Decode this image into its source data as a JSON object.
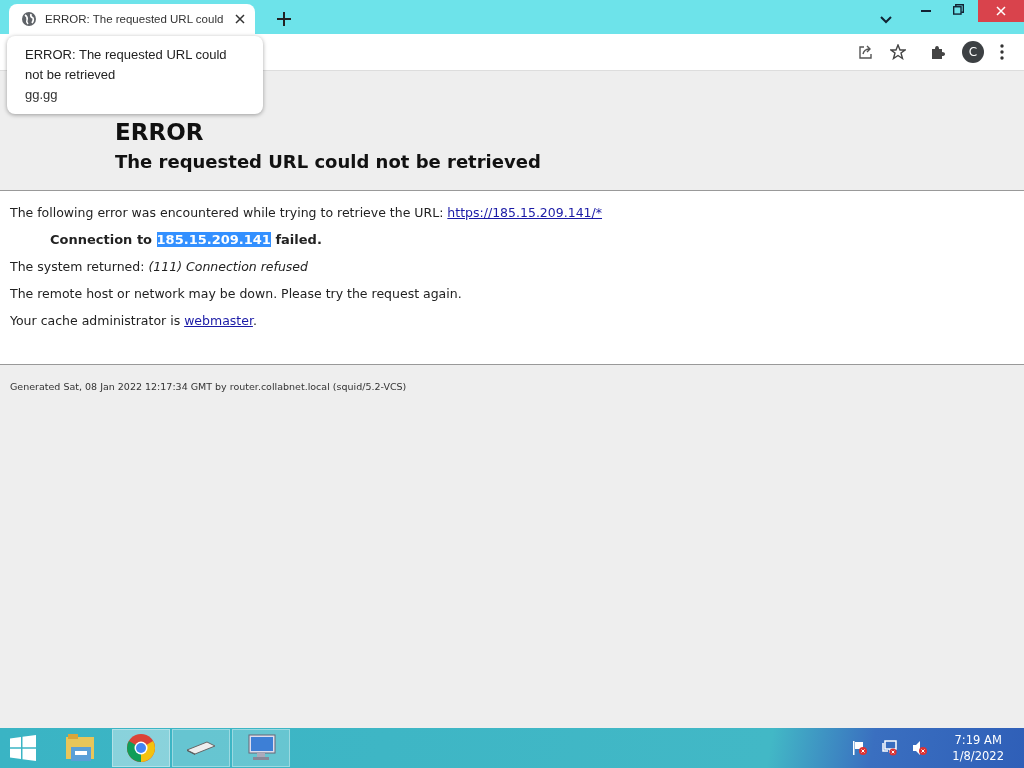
{
  "tabs": [
    {
      "title": "ERROR: The requested URL could",
      "selected": true
    }
  ],
  "tooltip": {
    "title": "ERROR: The requested URL could not be retrieved",
    "host": "gg.gg"
  },
  "profile": {
    "initial": "C"
  },
  "page": {
    "heading": "ERROR",
    "subheading": "The requested URL could not be retrieved",
    "intro": "The following error was encountered while trying to retrieve the URL:",
    "url": "https://185.15.209.141/*",
    "failure": {
      "before": "Connection to",
      "host": "185.15.209.141",
      "host_selected": true,
      "after": "failed."
    },
    "returned": {
      "label": "The system returned:",
      "detail": "(111) Connection refused"
    },
    "advice": "The remote host or network may be down. Please try the request again.",
    "admin": {
      "label": "Your cache administrator is",
      "link": "webmaster",
      "end": "."
    },
    "footer": "Generated Sat, 08 Jan 2022 12:17:34 GMT by router.collabnet.local (squid/5.2-VCS)"
  },
  "taskbar": {
    "apps": [
      {
        "kind": "explorer",
        "running": false,
        "selected": false
      },
      {
        "kind": "chrome",
        "running": true,
        "selected": true
      },
      {
        "kind": "device",
        "running": true,
        "selected": false
      },
      {
        "kind": "monitor",
        "running": true,
        "selected": false
      }
    ],
    "clock": {
      "time": "7:19 AM",
      "date": "1/8/2022"
    }
  }
}
